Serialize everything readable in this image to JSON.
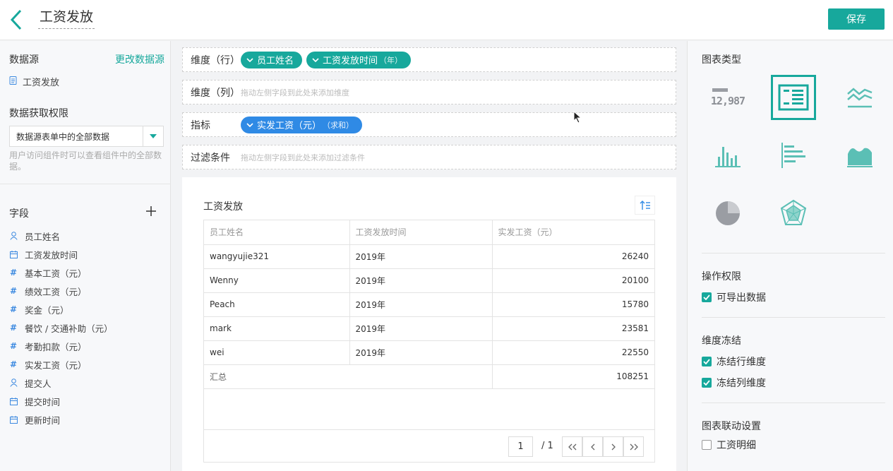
{
  "header": {
    "title": "工资发放",
    "save_label": "保存"
  },
  "left": {
    "datasource_title": "数据源",
    "change_datasource": "更改数据源",
    "datasource_item": "工资发放",
    "permission_title": "数据获取权限",
    "permission_value": "数据源表单中的全部数据",
    "permission_hint": "用户访问组件时可以查看组件中的全部数据。",
    "fields_title": "字段",
    "fields": [
      {
        "label": "员工姓名",
        "icon": "person"
      },
      {
        "label": "工资发放时间",
        "icon": "calendar"
      },
      {
        "label": "基本工资（元）",
        "icon": "hash"
      },
      {
        "label": "绩效工资（元）",
        "icon": "hash"
      },
      {
        "label": "奖金（元）",
        "icon": "hash"
      },
      {
        "label": "餐饮 / 交通补助（元）",
        "icon": "hash"
      },
      {
        "label": "考勤扣款（元）",
        "icon": "hash"
      },
      {
        "label": "实发工资（元）",
        "icon": "hash"
      },
      {
        "label": "提交人",
        "icon": "person"
      },
      {
        "label": "提交时间",
        "icon": "calendar"
      },
      {
        "label": "更新时间",
        "icon": "calendar"
      }
    ]
  },
  "zones": {
    "row_label": "维度（行）",
    "row_pill1": "员工姓名",
    "row_pill2": "工资发放时间",
    "row_pill2_sub": "（年）",
    "col_label": "维度（列）",
    "col_hint": "拖动左侧字段到此处来添加维度",
    "metric_label": "指标",
    "metric_pill": "实发工资（元）",
    "metric_pill_sub": "（求和）",
    "filter_label": "过滤条件",
    "filter_hint": "拖动左侧字段到此处来添加过滤条件"
  },
  "table": {
    "title": "工资发放",
    "headers": [
      "员工姓名",
      "工资发放时间",
      "实发工资（元）"
    ],
    "rows": [
      [
        "wangyujie321",
        "2019年",
        "26240"
      ],
      [
        "Wenny",
        "2019年",
        "20100"
      ],
      [
        "Peach",
        "2019年",
        "15780"
      ],
      [
        "mark",
        "2019年",
        "23581"
      ],
      [
        "wei",
        "2019年",
        "22550"
      ]
    ],
    "total_label": "汇总",
    "total_value": "108251",
    "page": "1",
    "page_total": "/ 1"
  },
  "right": {
    "chart_type_title": "图表类型",
    "number_card_value": "12,987",
    "op_title": "操作权限",
    "op_export": "可导出数据",
    "freeze_title": "维度冻结",
    "freeze_row": "冻结行维度",
    "freeze_col": "冻结列维度",
    "link_title": "图表联动设置",
    "link_item": "工资明细"
  },
  "colors": {
    "accent": "#17a89c",
    "blue": "#2f8ae5"
  }
}
